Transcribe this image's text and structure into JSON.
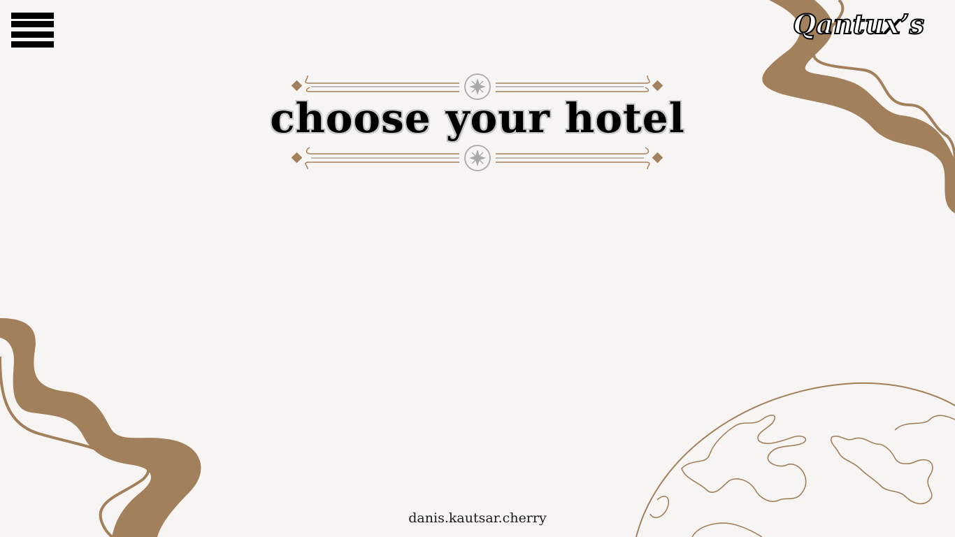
{
  "app": {
    "brand": "Qantux’s",
    "title": "choose your hotel",
    "credit": "danis.kautsar.cherry"
  },
  "icons": {
    "menu": "hamburger-menu-icon",
    "ornament_star": "compass-star-icon",
    "ornament_diamond": "diamond-icon",
    "globe": "globe-icon"
  },
  "colors": {
    "background": "#f7f5f3",
    "accent": "#a3805c",
    "text": "#000000",
    "ornament_gray": "#a9a9a9"
  }
}
